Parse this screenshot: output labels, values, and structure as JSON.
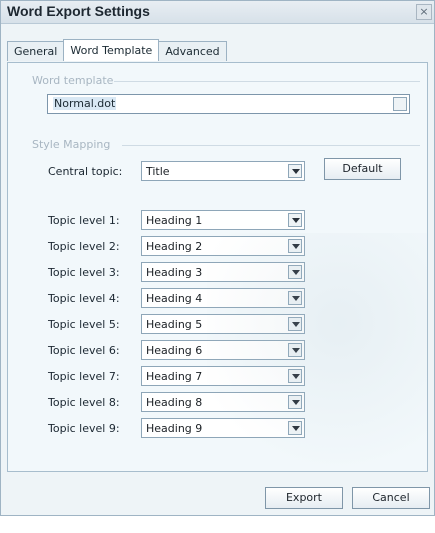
{
  "window": {
    "title": "Word Export Settings",
    "close_glyph": "×"
  },
  "tabs": [
    {
      "label": "General",
      "active": false
    },
    {
      "label": "Word Template",
      "active": true
    },
    {
      "label": "Advanced",
      "active": false
    }
  ],
  "word_template": {
    "section_label": "Word template",
    "value": "Normal.dot"
  },
  "style_mapping": {
    "section_label": "Style Mapping",
    "central_topic": {
      "label": "Central topic:",
      "value": "Title"
    },
    "default_button": "Default",
    "levels": [
      {
        "label": "Topic level 1:",
        "value": "Heading 1"
      },
      {
        "label": "Topic level 2:",
        "value": "Heading 2"
      },
      {
        "label": "Topic level 3:",
        "value": "Heading 3"
      },
      {
        "label": "Topic level 4:",
        "value": "Heading 4"
      },
      {
        "label": "Topic level 5:",
        "value": "Heading 5"
      },
      {
        "label": "Topic level 6:",
        "value": "Heading 6"
      },
      {
        "label": "Topic level 7:",
        "value": "Heading 7"
      },
      {
        "label": "Topic level 8:",
        "value": "Heading 8"
      },
      {
        "label": "Topic level 9:",
        "value": "Heading 9"
      }
    ]
  },
  "buttons": {
    "export": "Export",
    "cancel": "Cancel"
  }
}
